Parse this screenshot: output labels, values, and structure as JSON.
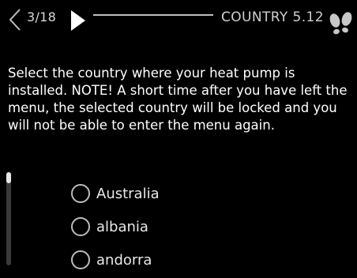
{
  "header": {
    "page_indicator": "3/18",
    "menu_title": "COUNTRY 5.12"
  },
  "icons": {
    "back": "chevron-left-outline-icon",
    "forward": "play-arrow-icon",
    "help": "footprints-icon"
  },
  "description": "Select the country where your heat pump is installed. NOTE! A short time after you have left the menu, the selected country will be locked and you will not be able to enter the menu again.",
  "options": [
    {
      "label": "Australia",
      "selected": false
    },
    {
      "label": "albania",
      "selected": false
    },
    {
      "label": "andorra",
      "selected": false
    }
  ],
  "scroll": {
    "position": 0.0
  },
  "colors": {
    "background": "#000000",
    "text": "#ffffff",
    "muted_text": "#cfcfcf",
    "radio_border": "#bcbcbc"
  }
}
